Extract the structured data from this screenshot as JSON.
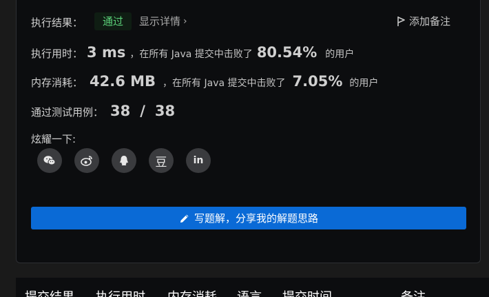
{
  "result": {
    "label": "执行结果：",
    "status": "通过",
    "detail_link": "显示详情",
    "add_note": "添加备注"
  },
  "runtime": {
    "label": "执行用时：",
    "value": "3 ms",
    "text_before": "，在所有 Java 提交中击败了",
    "percent": "80.54%",
    "text_after": "的用户"
  },
  "memory": {
    "label": "内存消耗：",
    "value": "42.6 MB",
    "text_before": "，在所有 Java 提交中击败了",
    "percent": "7.05%",
    "text_after": "的用户"
  },
  "tests": {
    "label": "通过测试用例：",
    "passed": "38",
    "separator": "/",
    "total": "38"
  },
  "share": {
    "label": "炫耀一下:",
    "items": [
      {
        "name": "wechat-icon",
        "glyph": ""
      },
      {
        "name": "weibo-icon",
        "glyph": ""
      },
      {
        "name": "qq-icon",
        "glyph": ""
      },
      {
        "name": "douban-icon",
        "glyph": "豆"
      },
      {
        "name": "linkedin-icon",
        "glyph": "in"
      }
    ]
  },
  "write_solution": {
    "label": "写题解，分享我的解题思路",
    "icon": "pencil-icon"
  },
  "table": {
    "headers": [
      "提交结果",
      "执行用时",
      "内存消耗",
      "语言",
      "提交时间",
      "备注"
    ]
  },
  "colors": {
    "accent": "#0a6ad6",
    "pass": "#5bd179",
    "card_bg": "#0c0d0f",
    "page_bg": "#1a1a1a"
  }
}
